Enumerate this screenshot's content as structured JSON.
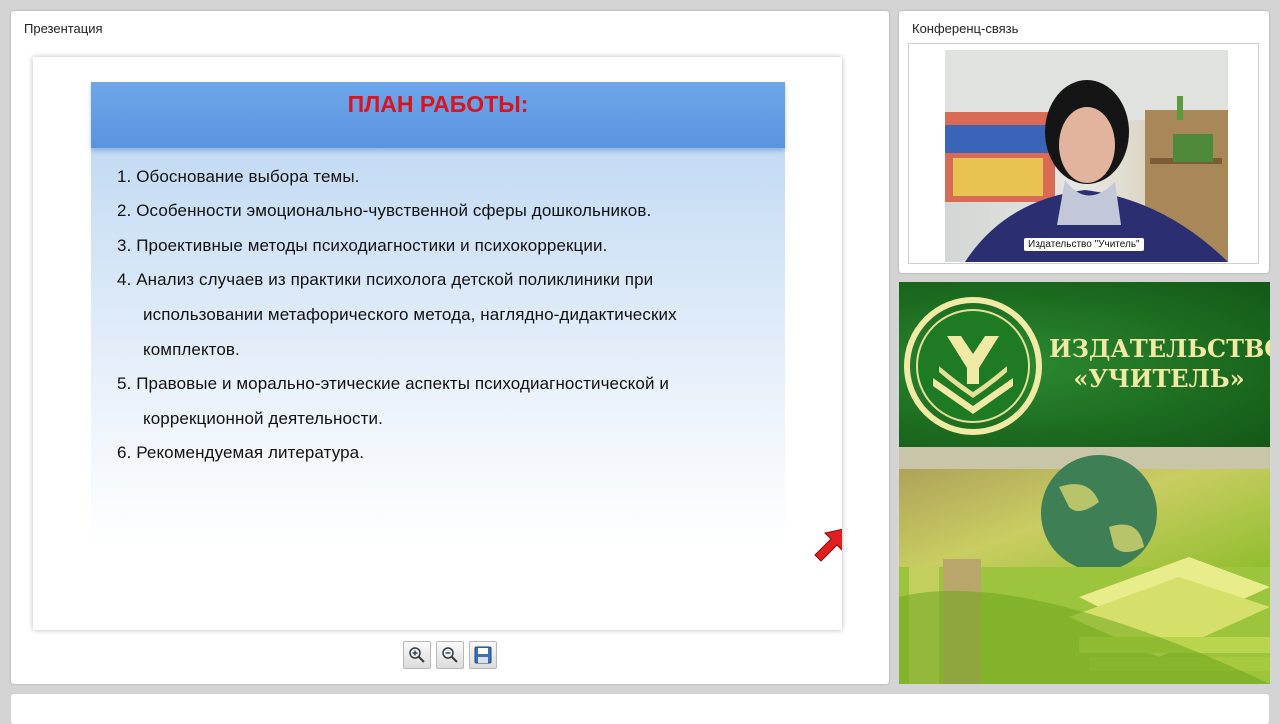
{
  "presentation": {
    "title": "Презентация",
    "slide": {
      "heading": "ПЛАН РАБОТЫ:",
      "lines": [
        "1.  Обоснование выбора темы.",
        "2.  Особенности эмоционально-чувственной сферы дошкольников.",
        "3.  Проективные методы психодиагностики и психокоррекции.",
        "4. Анализ случаев из практики психолога детской поликлиники при",
        "использовании  метафорического метода,  наглядно-дидактических",
        "комплектов.",
        "5. Правовые и морально-этические аспекты психодиагностической  и",
        "коррекционной деятельности.",
        "6. Рекомендуемая литература."
      ]
    },
    "toolbar": [
      {
        "name": "zoom-in",
        "icon": "zoom-in-icon"
      },
      {
        "name": "zoom-out",
        "icon": "zoom-out-icon"
      },
      {
        "name": "save",
        "icon": "floppy-disk-icon"
      }
    ]
  },
  "conference": {
    "title": "Конференц-связь",
    "participant_label": "Издательство \"Учитель\""
  },
  "ad": {
    "name_line1": "ИЗДАТЕЛЬСТВО",
    "name_line2": "«УЧИТЕЛЬ»"
  },
  "colors": {
    "slide_title": "#d9141e",
    "slide_header": "#5a94e0",
    "ad_green": "#1f6e20",
    "ad_text": "#f0eaa4"
  }
}
